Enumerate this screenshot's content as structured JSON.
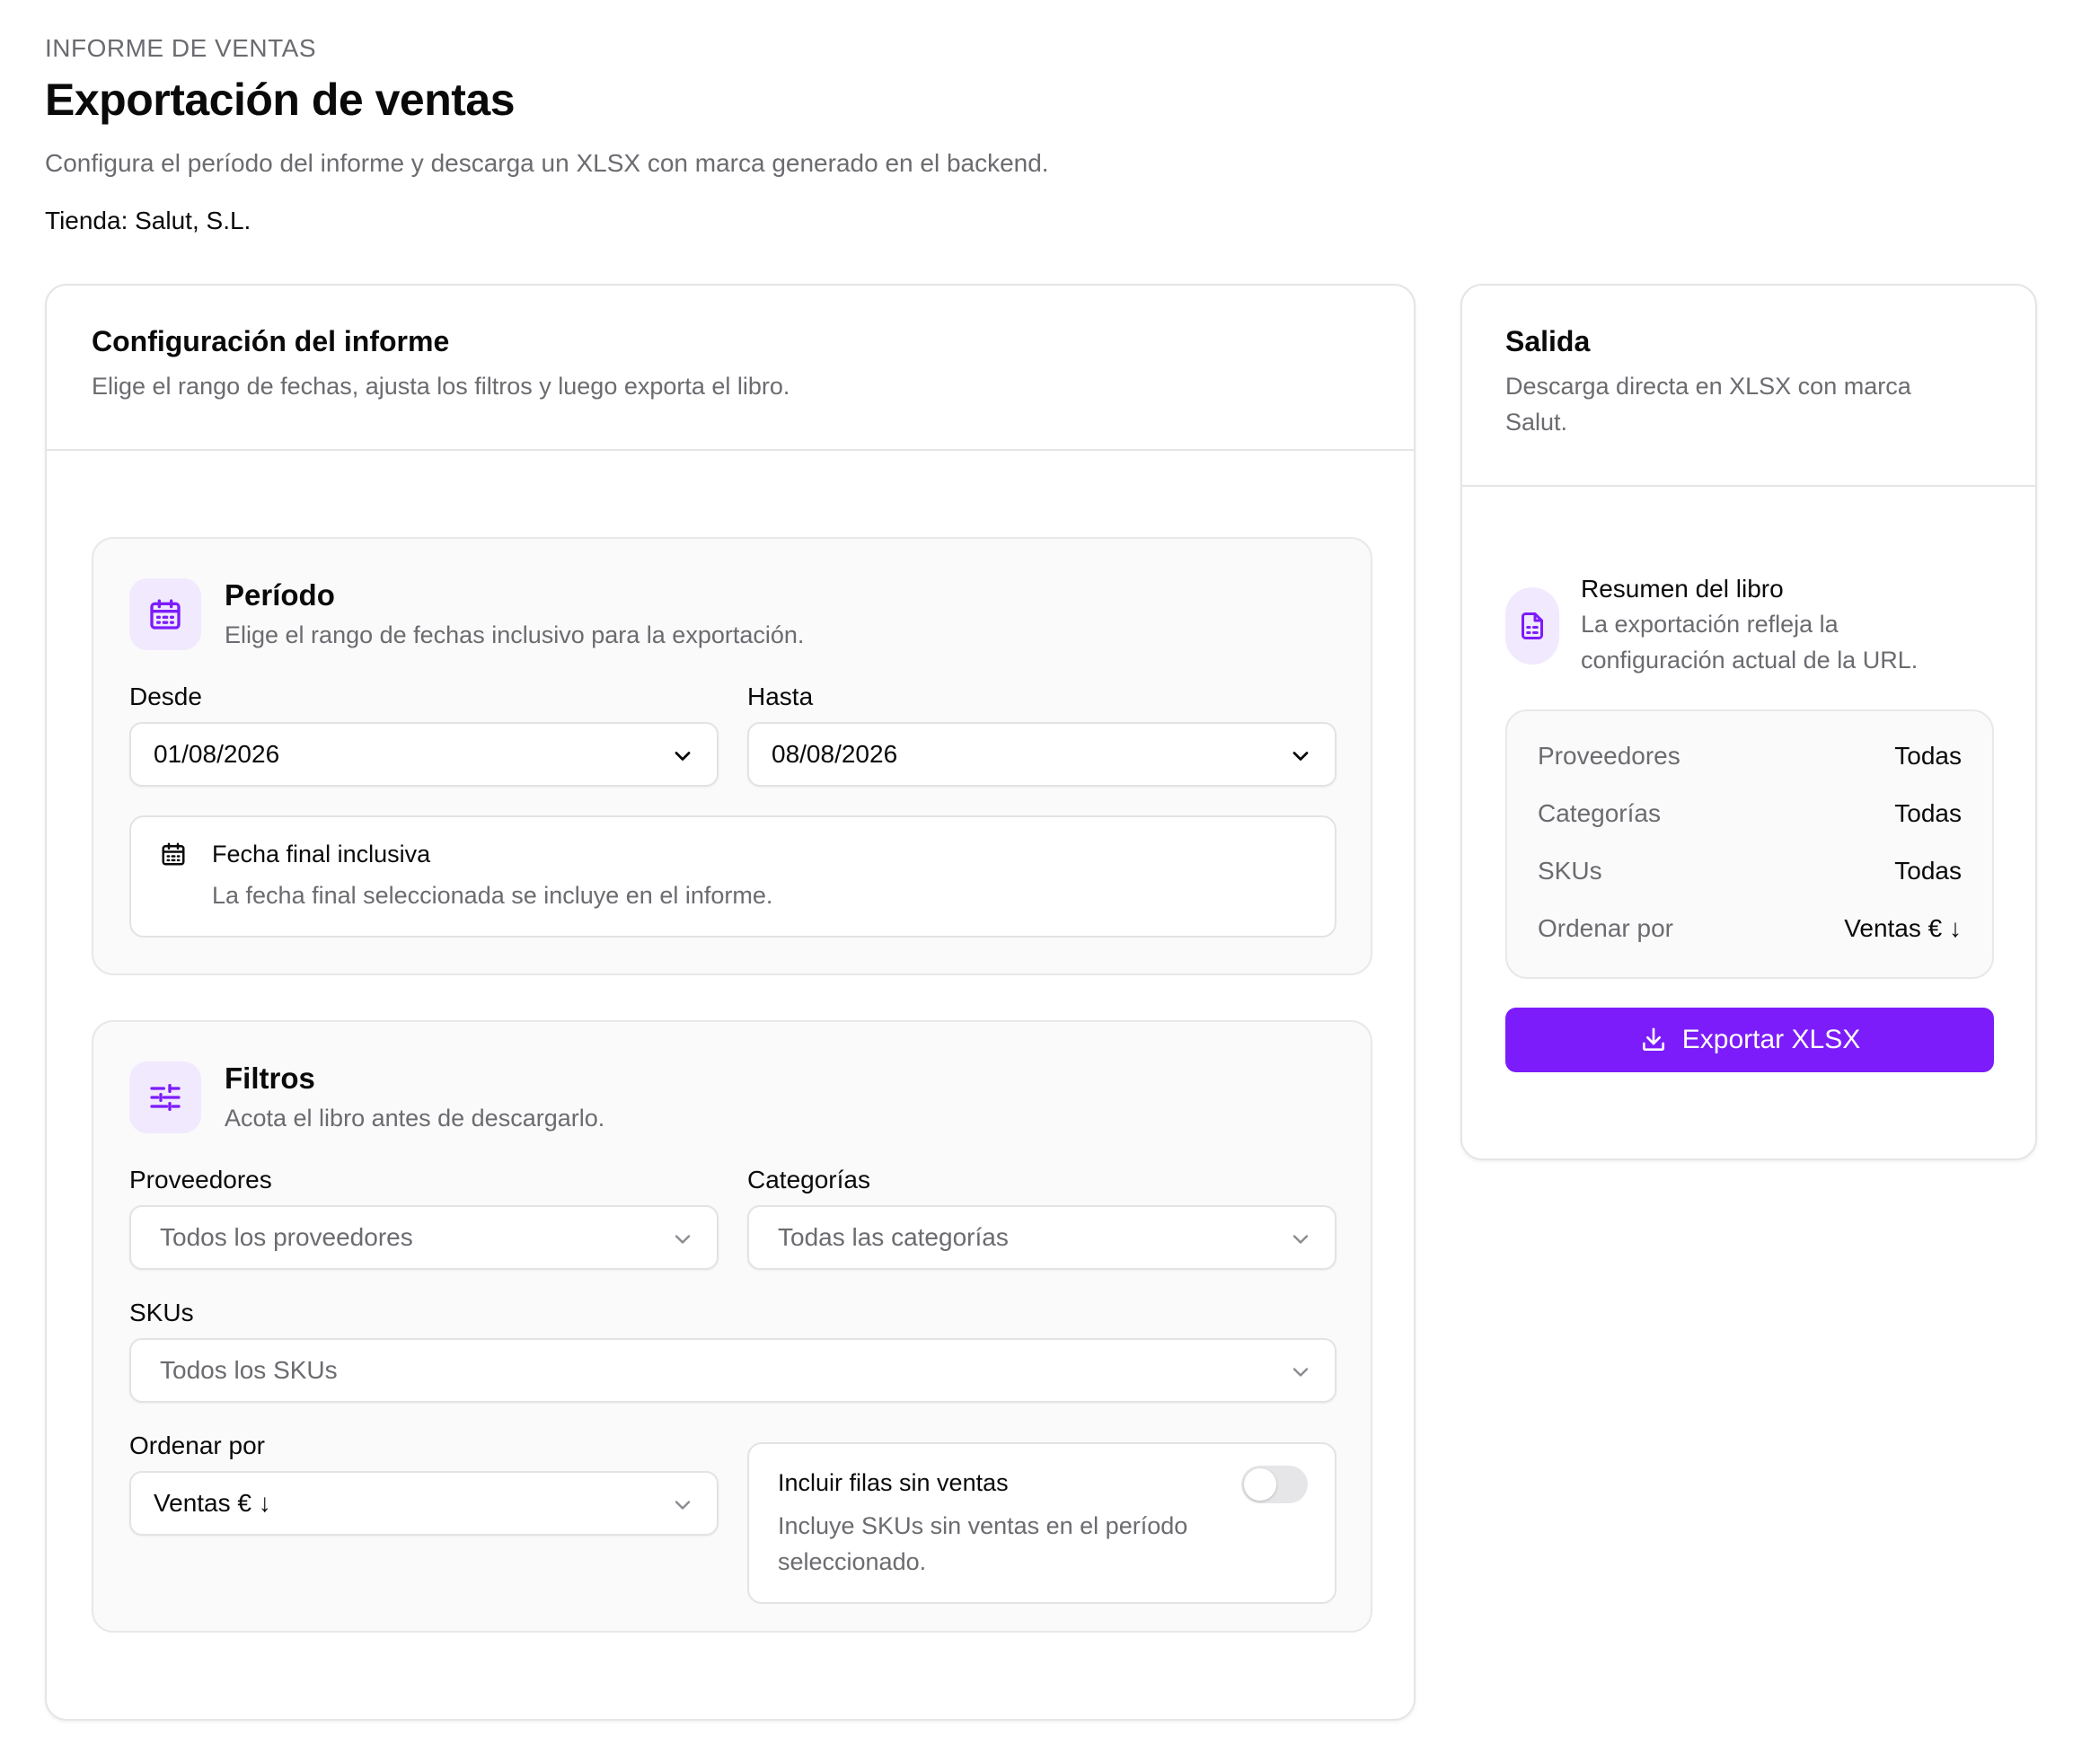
{
  "header": {
    "eyebrow": "INFORME DE VENTAS",
    "title": "Exportación de ventas",
    "subtitle": "Configura el período del informe y descarga un XLSX con marca generado en el backend.",
    "store": "Tienda: Salut, S.L."
  },
  "config_card": {
    "title": "Configuración del informe",
    "description": "Elige el rango de fechas, ajusta los filtros y luego exporta el libro."
  },
  "period": {
    "icon": "calendar-icon",
    "title": "Período",
    "description": "Elige el rango de fechas inclusivo para la exportación.",
    "from_label": "Desde",
    "from_value": "01/08/2026",
    "to_label": "Hasta",
    "to_value": "08/08/2026",
    "note_title": "Fecha final inclusiva",
    "note_text": "La fecha final seleccionada se incluye en el informe."
  },
  "filters": {
    "icon": "sliders-icon",
    "title": "Filtros",
    "description": "Acota el libro antes de descargarlo.",
    "suppliers_label": "Proveedores",
    "suppliers_placeholder": "Todos los proveedores",
    "categories_label": "Categorías",
    "categories_placeholder": "Todas las categorías",
    "skus_label": "SKUs",
    "skus_placeholder": "Todos los SKUs",
    "sort_label": "Ordenar por",
    "sort_value": "Ventas € ↓",
    "include_title": "Incluir filas sin ventas",
    "include_desc_1": "Incluye SKUs sin ventas en el período",
    "include_desc_2": "seleccionado.",
    "include_enabled": false
  },
  "output_card": {
    "title": "Salida",
    "description_1": "Descarga directa en XLSX con marca",
    "description_2": "Salut.",
    "summary_icon": "document-icon",
    "summary_title": "Resumen del libro",
    "summary_desc_1": "La exportación refleja la",
    "summary_desc_2": "configuración actual de la URL.",
    "rows": [
      {
        "key": "Proveedores",
        "value": "Todas"
      },
      {
        "key": "Categorías",
        "value": "Todas"
      },
      {
        "key": "SKUs",
        "value": "Todas"
      },
      {
        "key": "Ordenar por",
        "value": "Ventas € ↓"
      }
    ],
    "export_label": "Exportar XLSX",
    "export_icon": "download-icon"
  },
  "colors": {
    "accent": "#7c1cfa",
    "accent_soft": "#f1e9fe",
    "muted_text": "#6b6b70",
    "border": "#e5e5e8"
  }
}
